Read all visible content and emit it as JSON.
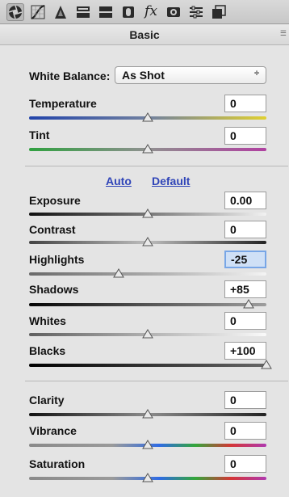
{
  "toolbar": {
    "icons": [
      "camera-raw-icon",
      "tone-curve-icon",
      "detail-icon",
      "hsl-icon",
      "split-toning-icon",
      "lens-correction-icon",
      "fx-icon",
      "camera-calibration-icon",
      "presets-icon",
      "snapshots-icon"
    ],
    "fx_label": "fx"
  },
  "section": {
    "title": "Basic"
  },
  "white_balance": {
    "label": "White Balance:",
    "value": "As Shot",
    "arrow": "÷"
  },
  "controls": {
    "temperature": {
      "label": "Temperature",
      "value": "0"
    },
    "tint": {
      "label": "Tint",
      "value": "0"
    },
    "exposure": {
      "label": "Exposure",
      "value": "0.00"
    },
    "contrast": {
      "label": "Contrast",
      "value": "0"
    },
    "highlights": {
      "label": "Highlights",
      "value": "-25"
    },
    "shadows": {
      "label": "Shadows",
      "value": "+85"
    },
    "whites": {
      "label": "Whites",
      "value": "0"
    },
    "blacks": {
      "label": "Blacks",
      "value": "+100"
    },
    "clarity": {
      "label": "Clarity",
      "value": "0"
    },
    "vibrance": {
      "label": "Vibrance",
      "value": "0"
    },
    "saturation": {
      "label": "Saturation",
      "value": "0"
    }
  },
  "links": {
    "auto": "Auto",
    "default": "Default"
  },
  "colors": {
    "selected_box": "#cfe0f6",
    "link": "#2f44b8",
    "temperature_track": [
      "#2244aa",
      "#e0d030"
    ],
    "tint_track": [
      "#30a040",
      "#b040a0"
    ]
  }
}
